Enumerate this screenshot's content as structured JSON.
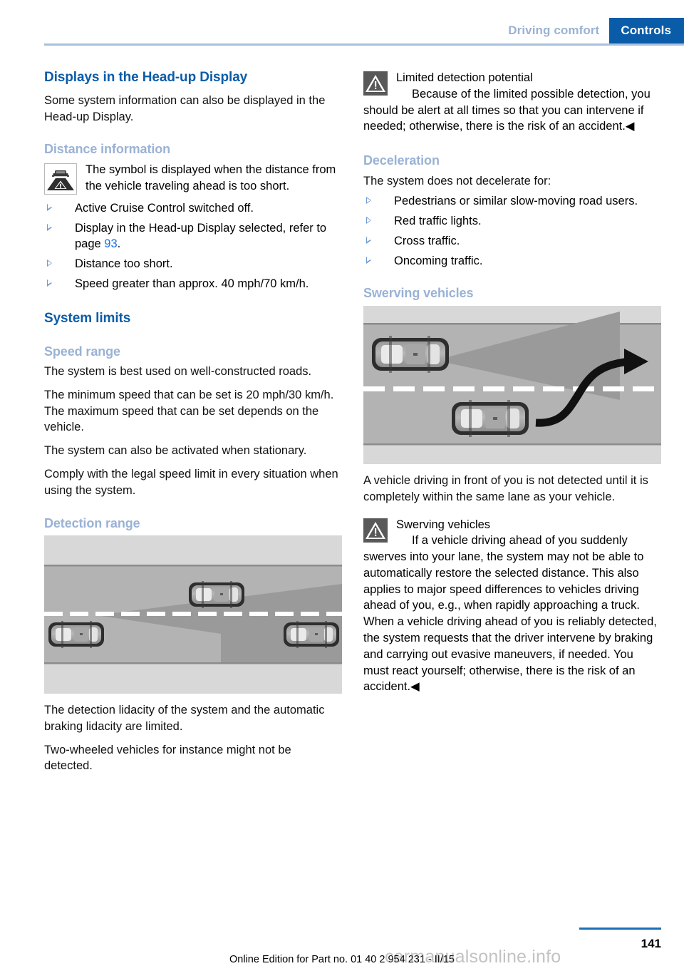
{
  "header": {
    "breadcrumb_section": "Driving comfort",
    "breadcrumb_chapter": "Controls",
    "accent_blue": "#0a5ca8",
    "muted_blue": "#9ab2d4"
  },
  "left_column": {
    "title": "Displays in the Head-up Display",
    "intro": "Some system information can also be displayed in the Head-up Display.",
    "distance_info": {
      "heading": "Distance information",
      "symbol_text": "The symbol is displayed when the distance from the vehicle traveling ahead is too short.",
      "bullets": [
        {
          "text_before": "Active Cruise Control switched off.",
          "link": "",
          "text_after": ""
        },
        {
          "text_before": "Display in the Head-up Display selected, refer to page ",
          "link": "93",
          "text_after": "."
        },
        {
          "text_before": "Distance too short.",
          "link": "",
          "text_after": ""
        },
        {
          "text_before": "Speed greater than approx. 40 mph/70 km/h.",
          "link": "",
          "text_after": ""
        }
      ]
    },
    "system_limits": {
      "heading": "System limits",
      "speed_range": {
        "heading": "Speed range",
        "p1": "The system is best used on well-constructed roads.",
        "p2": "The minimum speed that can be set is 20 mph/30 km/h. The maximum speed that can be set depends on the vehicle.",
        "p3": "The system can also be activated when stationary.",
        "p4": "Comply with the legal speed limit in every situation when using the system."
      },
      "detection_range": {
        "heading": "Detection range",
        "figure_caption": "detection-range-diagram",
        "p1": "The detection lidacity of the system and the automatic braking lidacity are limited.",
        "p2": "Two-wheeled vehicles for instance might not be detected."
      }
    }
  },
  "right_column": {
    "warning_limited": {
      "title": "Limited detection potential",
      "body": "Because of the limited possible detection, you should be alert at all times so that you can intervene if needed; otherwise, there is the risk of an accident.◀"
    },
    "deceleration": {
      "heading": "Deceleration",
      "intro": "The system does not decelerate for:",
      "bullets": [
        "Pedestrians or similar slow-moving road users.",
        "Red traffic lights.",
        "Cross traffic.",
        "Oncoming traffic."
      ]
    },
    "swerving": {
      "heading": "Swerving vehicles",
      "figure_caption": "swerving-vehicles-diagram",
      "caption_text": "A vehicle driving in front of you is not detected until it is completely within the same lane as your vehicle.",
      "warning_title": "Swerving vehicles",
      "warning_body": "If a vehicle driving ahead of you suddenly swerves into your lane, the system may not be able to automatically restore the selected distance. This also applies to major speed differences to vehicles driving ahead of you, e.g., when rapidly approaching a truck. When a vehicle driving ahead of you is reliably detected, the system requests that the driver intervene by braking and carrying out evasive maneuvers, if needed. You must react yourself; otherwise, there is the risk of an accident.◀"
    }
  },
  "footer": {
    "edition_text": "Online Edition for Part no. 01 40 2 954 231 - II/15",
    "page_number": "141",
    "watermark": "carmanualsonline.info"
  }
}
